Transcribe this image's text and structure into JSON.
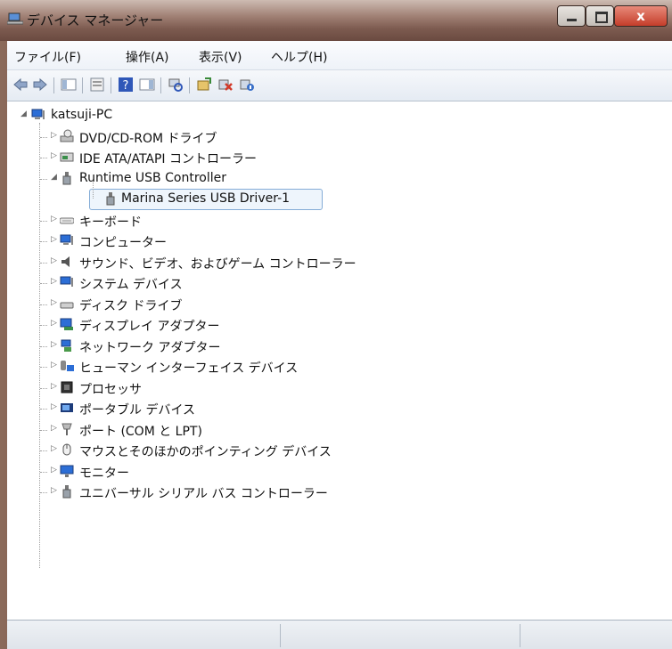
{
  "window": {
    "title": "デバイス マネージャー",
    "close_label": "x"
  },
  "menu": [
    {
      "label": "ファイル(F)"
    },
    {
      "label": "操作(A)"
    },
    {
      "label": "表示(V)"
    },
    {
      "label": "ヘルプ(H)"
    }
  ],
  "toolbar": {
    "buttons": [
      "back-icon",
      "forward-icon",
      "properties-view-icon",
      "console-icon",
      "help-icon",
      "action-pane-icon",
      "scan-hardware-icon",
      "update-driver-icon",
      "uninstall-icon",
      "disable-icon"
    ]
  },
  "tree": {
    "root": "katsuji-PC",
    "items": [
      {
        "label": "DVD/CD-ROM ドライブ",
        "icon": "dvd-drive-icon",
        "expanded": false
      },
      {
        "label": "IDE ATA/ATAPI コントローラー",
        "icon": "ide-controller-icon",
        "expanded": false
      },
      {
        "label": "Runtime USB Controller",
        "icon": "usb-plug-icon",
        "expanded": true
      },
      {
        "label": "Marina Series USB Driver-1",
        "icon": "usb-plug-icon",
        "child": true,
        "selected": true
      },
      {
        "label": "キーボード",
        "icon": "keyboard-icon",
        "expanded": false
      },
      {
        "label": "コンピューター",
        "icon": "computer-icon",
        "expanded": false
      },
      {
        "label": "サウンド、ビデオ、およびゲーム コントローラー",
        "icon": "speaker-icon",
        "expanded": false
      },
      {
        "label": "システム デバイス",
        "icon": "system-devices-icon",
        "expanded": false
      },
      {
        "label": "ディスク ドライブ",
        "icon": "disk-drive-icon",
        "expanded": false
      },
      {
        "label": "ディスプレイ アダプター",
        "icon": "display-adapter-icon",
        "expanded": false
      },
      {
        "label": "ネットワーク アダプター",
        "icon": "network-adapter-icon",
        "expanded": false
      },
      {
        "label": "ヒューマン インターフェイス デバイス",
        "icon": "hid-icon",
        "expanded": false
      },
      {
        "label": "プロセッサ",
        "icon": "processor-icon",
        "expanded": false
      },
      {
        "label": "ポータブル デバイス",
        "icon": "portable-device-icon",
        "expanded": false
      },
      {
        "label": "ポート (COM と LPT)",
        "icon": "port-icon",
        "expanded": false
      },
      {
        "label": "マウスとそのほかのポインティング デバイス",
        "icon": "mouse-icon",
        "expanded": false
      },
      {
        "label": "モニター",
        "icon": "monitor-icon",
        "expanded": false
      },
      {
        "label": "ユニバーサル シリアル バス コントローラー",
        "icon": "usb-plug-icon",
        "expanded": false
      }
    ]
  }
}
